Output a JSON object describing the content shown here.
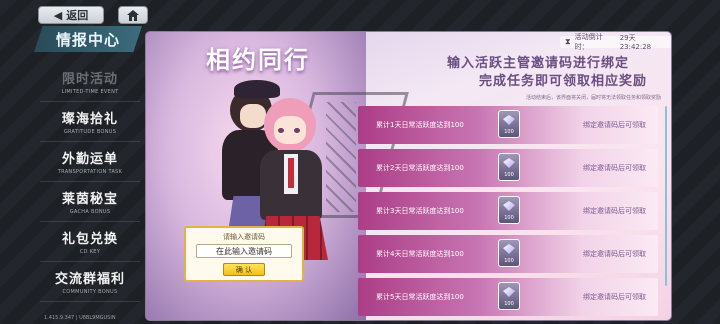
{
  "topbar": {
    "back_label": "返回"
  },
  "sidebar": {
    "title": "情报中心",
    "items": [
      {
        "cn": "限时活动",
        "en": "LIMITED-TIME EVENT"
      },
      {
        "cn": "璨海拾礼",
        "en": "GRATITUDE BONUS"
      },
      {
        "cn": "外勤运单",
        "en": "TRANSPORTATION TASK"
      },
      {
        "cn": "莱茵秘宝",
        "en": "GACHA BONUS"
      },
      {
        "cn": "礼包兑换",
        "en": "CD KEY"
      },
      {
        "cn": "交流群福利",
        "en": "COMMUNITY BONUS"
      }
    ],
    "version": "1.415.9.347 | U8BL9MGUSIN"
  },
  "event": {
    "title": "相约同行",
    "timer_label": "活动倒计时：",
    "timer_value": "29天23:42:28",
    "headline_1": "输入活跃主管邀请码进行绑定",
    "headline_2": "完成任务即可领取相应奖励",
    "note": "活动结束后，该界面将关闭，届时将无法领取任务和领取奖励"
  },
  "tasks": [
    {
      "text": "累计1天日常活跃度达到100",
      "qty": "100",
      "status": "绑定邀请码后可领取"
    },
    {
      "text": "累计2天日常活跃度达到100",
      "qty": "100",
      "status": "绑定邀请码后可领取"
    },
    {
      "text": "累计3天日常活跃度达到100",
      "qty": "100",
      "status": "绑定邀请码后可领取"
    },
    {
      "text": "累计4天日常活跃度达到100",
      "qty": "100",
      "status": "绑定邀请码后可领取"
    },
    {
      "text": "累计5天日常活跃度达到100",
      "qty": "100",
      "status": "绑定邀请码后可领取"
    }
  ],
  "invite": {
    "label": "请输入邀请码",
    "placeholder": "在此输入邀请码",
    "confirm_label": "确 认"
  },
  "colors": {
    "accent_pink": "#ac3d86",
    "confirm_yellow": "#f2c018",
    "sidebar_teal": "#3c6c7c"
  }
}
